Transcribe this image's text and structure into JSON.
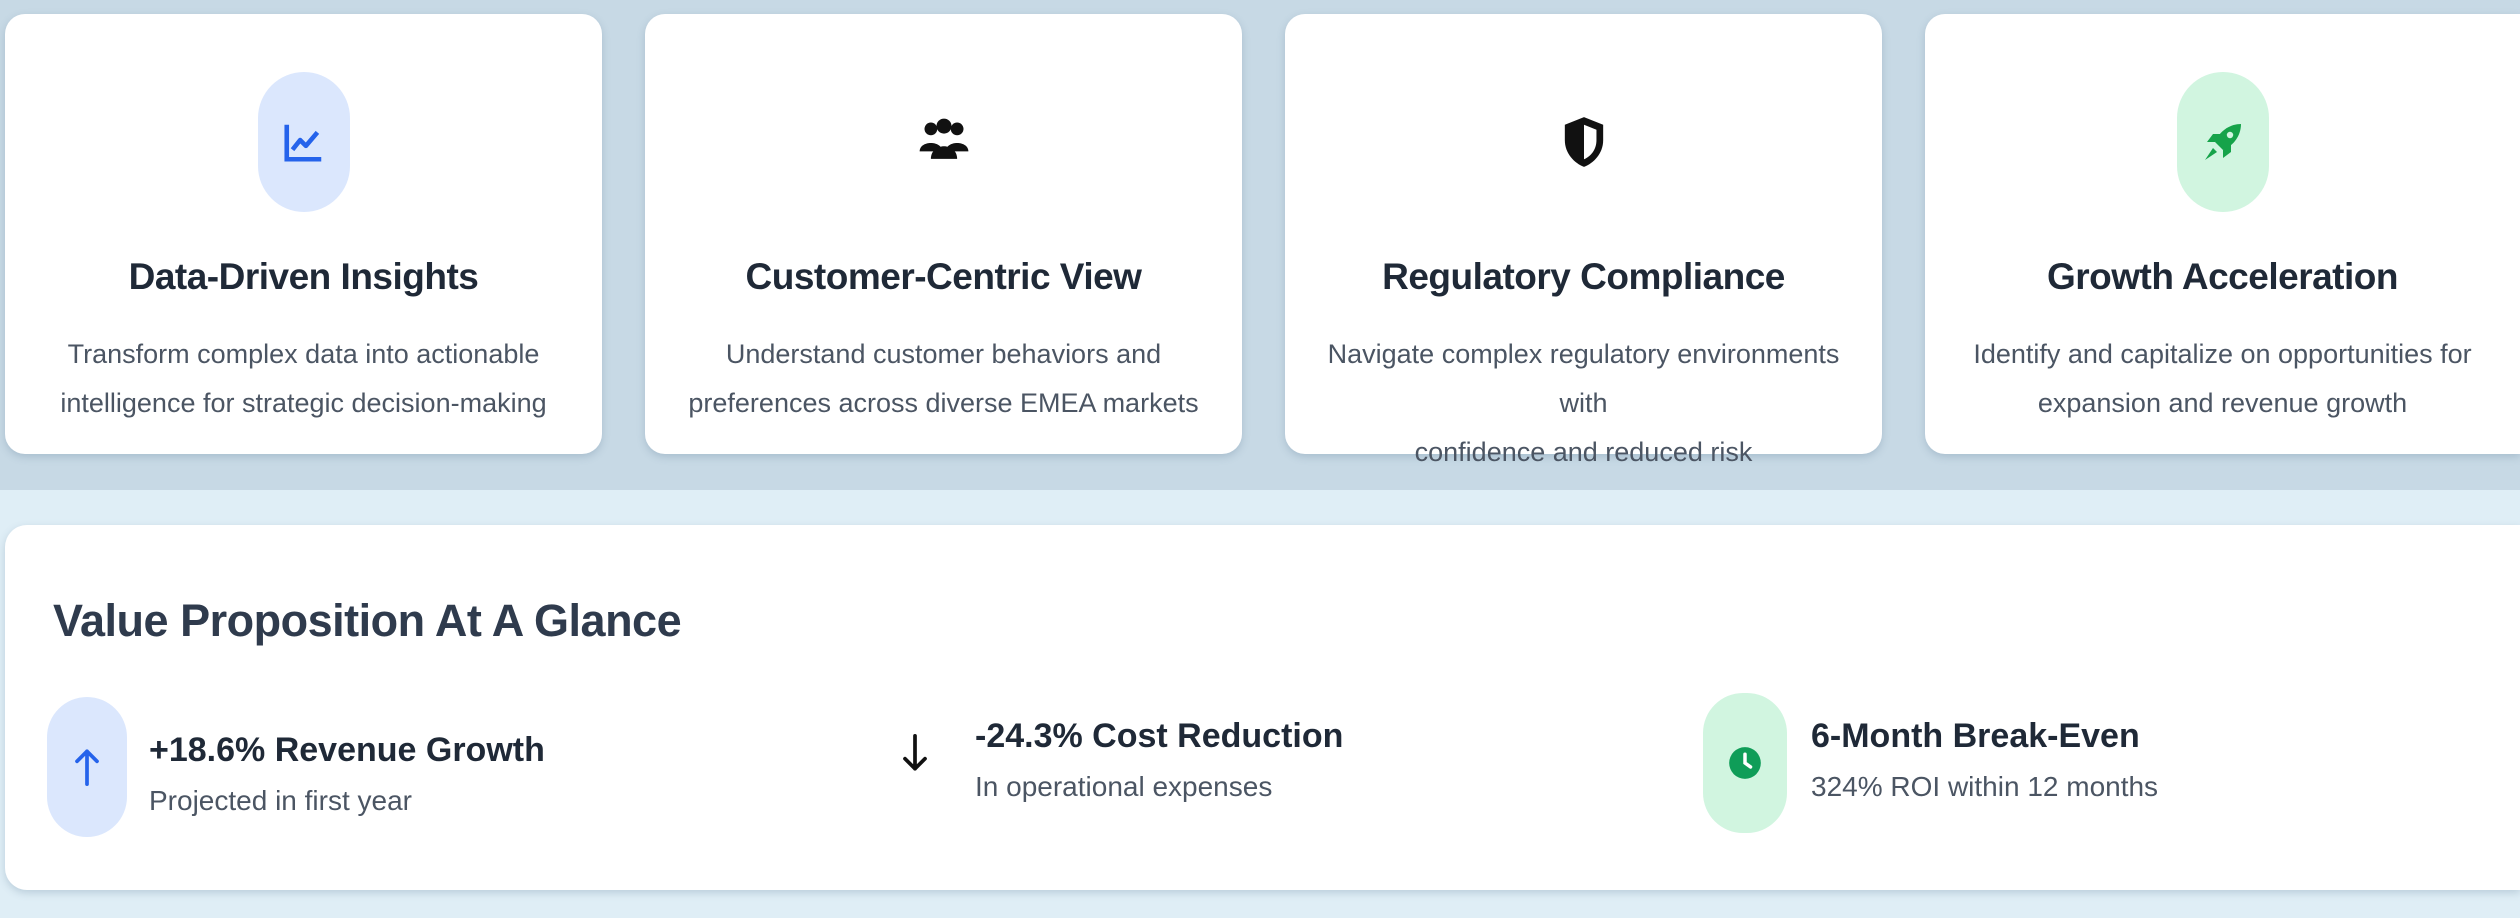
{
  "features": [
    {
      "title": "Data-Driven Insights",
      "description_line1": "Transform complex data into actionable",
      "description_line2": "intelligence for strategic decision-making",
      "icon": "chart-line-icon",
      "icon_bg": "#dbe7fd",
      "icon_color": "#2563eb"
    },
    {
      "title": "Customer-Centric View",
      "description_line1": "Understand customer behaviors and",
      "description_line2": "preferences across diverse EMEA markets",
      "icon": "users-icon",
      "icon_bg": "",
      "icon_color": "#111111"
    },
    {
      "title": "Regulatory Compliance",
      "description_line1": "Navigate complex regulatory environments with",
      "description_line2": "confidence and reduced risk",
      "icon": "shield-icon",
      "icon_bg": "",
      "icon_color": "#111111"
    },
    {
      "title": "Growth Acceleration",
      "description_line1": "Identify and capitalize on opportunities for",
      "description_line2": "expansion and revenue growth",
      "icon": "rocket-icon",
      "icon_bg": "#d1f5e0",
      "icon_color": "#16a34a"
    }
  ],
  "value_proposition": {
    "title": "Value Proposition At A Glance",
    "metrics": [
      {
        "label": "+18.6% Revenue Growth",
        "sub": "Projected in first year",
        "icon": "arrow-up-icon",
        "icon_bg": "#dbe7fd",
        "icon_color": "#2563eb"
      },
      {
        "label": "-24.3% Cost Reduction",
        "sub": "In operational expenses",
        "icon": "arrow-down-icon",
        "icon_bg": "",
        "icon_color": "#111111"
      },
      {
        "label": "6-Month Break-Even",
        "sub": "324% ROI within 12 months",
        "icon": "clock-icon",
        "icon_bg": "#d1f5e0",
        "icon_color": "#0f9d58"
      }
    ]
  }
}
